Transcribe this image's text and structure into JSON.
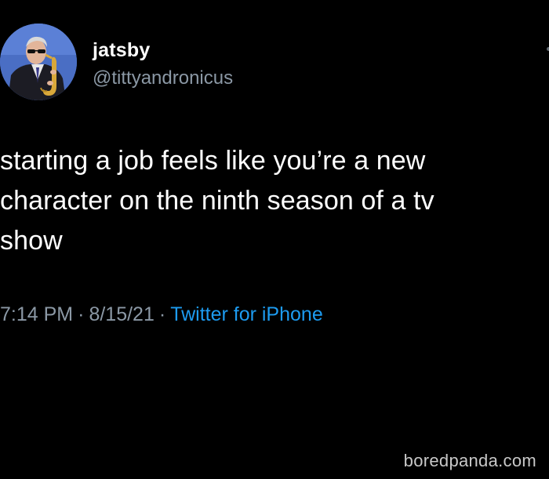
{
  "tweet": {
    "author": {
      "display_name": "jatsby",
      "handle": "@tittyandronicus"
    },
    "text_lines": [
      "starting a job feels like you’re a new",
      "character on the ninth season of a tv",
      "show"
    ],
    "meta": {
      "time": "7:14 PM",
      "separator": "·",
      "date": "8/15/21",
      "source": "Twitter for iPhone"
    }
  },
  "watermark": {
    "text": "boredpanda.com"
  },
  "colors": {
    "background": "#000000",
    "text_primary": "#ffffff",
    "text_secondary": "#8b98a5",
    "link": "#1d9bf0"
  },
  "icons": {
    "avatar": "avatar-saxophone-player",
    "more": "more-dot-icon"
  }
}
